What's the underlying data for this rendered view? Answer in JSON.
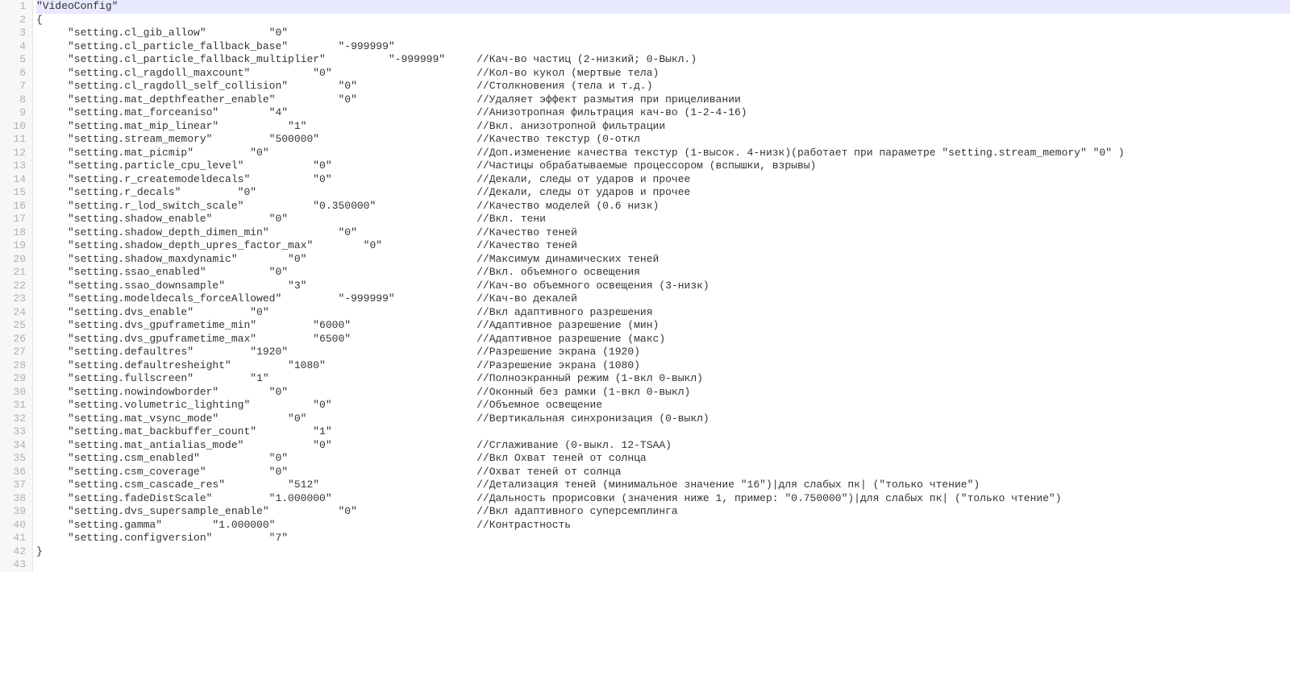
{
  "root_key": "\"VideoConfig\"",
  "open_brace": "{",
  "close_brace": "}",
  "indent_unit": 5,
  "key_col_width": 43,
  "val_col_start": 40,
  "comment_col": 70,
  "lines": [
    {
      "key": "\"setting.cl_gib_allow\"",
      "value": "\"0\"",
      "val_pos": 37,
      "comment": ""
    },
    {
      "key": "\"setting.cl_particle_fallback_base\"",
      "value": "\"-999999\"",
      "val_pos": 48,
      "comment": ""
    },
    {
      "key": "\"setting.cl_particle_fallback_multiplier\"",
      "value": "\"-999999\"",
      "val_pos": 56,
      "comment": "//Кач-во частиц (2-низкий; 0-Выкл.)"
    },
    {
      "key": "\"setting.cl_ragdoll_maxcount\"",
      "value": "\"0\"",
      "val_pos": 44,
      "comment": "//Кол-во кукол (мертвые тела)"
    },
    {
      "key": "\"setting.cl_ragdoll_self_collision\"",
      "value": "\"0\"",
      "val_pos": 48,
      "comment": "//Столкновения (тела и т.д.)"
    },
    {
      "key": "\"setting.mat_depthfeather_enable\"",
      "value": "\"0\"",
      "val_pos": 48,
      "comment": "//Удаляет эффект размытия при прицеливании"
    },
    {
      "key": "\"setting.mat_forceaniso\"",
      "value": "\"4\"",
      "val_pos": 37,
      "comment": "//Анизотропная фильтрация кач-во (1-2-4-16)"
    },
    {
      "key": "\"setting.mat_mip_linear\"",
      "value": "\"1\"",
      "val_pos": 40,
      "comment": "//Вкл. анизотропной фильтрации"
    },
    {
      "key": "\"setting.stream_memory\"",
      "value": "\"500000\"",
      "val_pos": 37,
      "comment": "//Качество текстур (0-откл"
    },
    {
      "key": "\"setting.mat_picmip\"",
      "value": "\"0\"",
      "val_pos": 34,
      "comment": "//Доп.изменение качества текстур (1-высок. 4-низк)(работает при параметре \"setting.stream_memory\" \"0\" )"
    },
    {
      "key": "\"setting.particle_cpu_level\"",
      "value": "\"0\"",
      "val_pos": 44,
      "comment": "//Частицы обрабатываемые процессором (вспышки, взрывы)"
    },
    {
      "key": "\"setting.r_createmodeldecals\"",
      "value": "\"0\"",
      "val_pos": 44,
      "comment": "//Декали, следы от ударов и прочее"
    },
    {
      "key": "\"setting.r_decals\"",
      "value": "\"0\"",
      "val_pos": 32,
      "comment": "//Декали, следы от ударов и прочее"
    },
    {
      "key": "\"setting.r_lod_switch_scale\"",
      "value": "\"0.350000\"",
      "val_pos": 44,
      "comment": "//Качество моделей (0.6 низк)"
    },
    {
      "key": "\"setting.shadow_enable\"",
      "value": "\"0\"",
      "val_pos": 37,
      "comment": "//Вкл. тени"
    },
    {
      "key": "\"setting.shadow_depth_dimen_min\"",
      "value": "\"0\"",
      "val_pos": 48,
      "comment": "//Качество теней"
    },
    {
      "key": "\"setting.shadow_depth_upres_factor_max\"",
      "value": "\"0\"",
      "val_pos": 52,
      "comment": "//Качество теней"
    },
    {
      "key": "\"setting.shadow_maxdynamic\"",
      "value": "\"0\"",
      "val_pos": 40,
      "comment": "//Максимум динамических теней"
    },
    {
      "key": "\"setting.ssao_enabled\"",
      "value": "\"0\"",
      "val_pos": 37,
      "comment": "//Вкл. объемного освещения"
    },
    {
      "key": "\"setting.ssao_downsample\"",
      "value": "\"3\"",
      "val_pos": 40,
      "comment": "//Кач-во объемного освещения (3-низк)"
    },
    {
      "key": "\"setting.modeldecals_forceAllowed\"",
      "value": "\"-999999\"",
      "val_pos": 48,
      "comment": "//Кач-во декалей"
    },
    {
      "key": "\"setting.dvs_enable\"",
      "value": "\"0\"",
      "val_pos": 34,
      "comment": "//Вкл адаптивного разрешения"
    },
    {
      "key": "\"setting.dvs_gpuframetime_min\"",
      "value": "\"6000\"",
      "val_pos": 44,
      "comment": "//Адаптивное разрешение (мин)"
    },
    {
      "key": "\"setting.dvs_gpuframetime_max\"",
      "value": "\"6500\"",
      "val_pos": 44,
      "comment": "//Адаптивное разрешение (макс)"
    },
    {
      "key": "\"setting.defaultres\"",
      "value": "\"1920\"",
      "val_pos": 34,
      "comment": "//Разрешение экрана (1920)"
    },
    {
      "key": "\"setting.defaultresheight\"",
      "value": "\"1080\"",
      "val_pos": 40,
      "comment": "//Разрешение экрана (1080)"
    },
    {
      "key": "\"setting.fullscreen\"",
      "value": "\"1\"",
      "val_pos": 34,
      "comment": "//Полноэкранный режим (1-вкл 0-выкл)"
    },
    {
      "key": "\"setting.nowindowborder\"",
      "value": "\"0\"",
      "val_pos": 37,
      "comment": "//Оконный без рамки (1-вкл 0-выкл)"
    },
    {
      "key": "\"setting.volumetric_lighting\"",
      "value": "\"0\"",
      "val_pos": 44,
      "comment": "//Объемное освещение"
    },
    {
      "key": "\"setting.mat_vsync_mode\"",
      "value": "\"0\"",
      "val_pos": 40,
      "comment": "//Вертикальная синхронизация (0-выкл)"
    },
    {
      "key": "\"setting.mat_backbuffer_count\"",
      "value": "\"1\"",
      "val_pos": 44,
      "comment": ""
    },
    {
      "key": "\"setting.mat_antialias_mode\"",
      "value": "\"0\"",
      "val_pos": 44,
      "comment": "//Сглаживание (0-выкл. 12-TSAA)"
    },
    {
      "key": "\"setting.csm_enabled\"",
      "value": "\"0\"",
      "val_pos": 37,
      "comment": "//Вкл Охват теней от солнца"
    },
    {
      "key": "\"setting.csm_coverage\"",
      "value": "\"0\"",
      "val_pos": 37,
      "comment": "//Охват теней от солнца"
    },
    {
      "key": "\"setting.csm_cascade_res\"",
      "value": "\"512\"",
      "val_pos": 40,
      "comment": "//Детализация теней (минимальное значение \"16\")|для слабых пк| (\"только чтение\")"
    },
    {
      "key": "\"setting.fadeDistScale\"",
      "value": "\"1.000000\"",
      "val_pos": 37,
      "comment": "//Дальность прорисовки (значения ниже 1, пример: \"0.750000\")|для слабых пк| (\"только чтение\")"
    },
    {
      "key": "\"setting.dvs_supersample_enable\"",
      "value": "\"0\"",
      "val_pos": 48,
      "comment": "//Вкл адаптивного суперсемплинга"
    },
    {
      "key": "\"setting.gamma\"",
      "value": "\"1.000000\"",
      "val_pos": 28,
      "comment": "//Контрастность"
    },
    {
      "key": "\"setting.configversion\"",
      "value": "\"7\"",
      "val_pos": 37,
      "comment": ""
    }
  ],
  "total_lines": 43,
  "current_line": 1
}
